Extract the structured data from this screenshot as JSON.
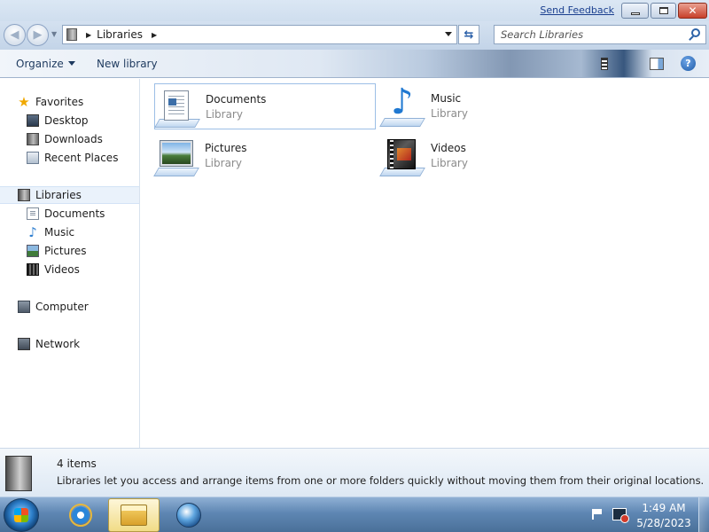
{
  "titlebar": {
    "feedback_link": "Send Feedback",
    "minimize": "minimize",
    "maximize": "maximize",
    "close": "✕"
  },
  "address": {
    "crumb": "Libraries",
    "search_placeholder": "Search Libraries"
  },
  "toolbar": {
    "organize_label": "Organize",
    "new_library_label": "New library",
    "help_label": "?"
  },
  "nav": {
    "favorites": "Favorites",
    "desktop": "Desktop",
    "downloads": "Downloads",
    "recent_places": "Recent Places",
    "libraries": "Libraries",
    "documents": "Documents",
    "music": "Music",
    "pictures": "Pictures",
    "videos": "Videos",
    "computer": "Computer",
    "network": "Network"
  },
  "libraries": [
    {
      "name": "Documents",
      "type": "Library",
      "icon": "documents-library-icon"
    },
    {
      "name": "Music",
      "type": "Library",
      "icon": "music-library-icon"
    },
    {
      "name": "Pictures",
      "type": "Library",
      "icon": "pictures-library-icon"
    },
    {
      "name": "Videos",
      "type": "Library",
      "icon": "videos-library-icon"
    }
  ],
  "details": {
    "count": "4 items",
    "description": "Libraries let you access and arrange items from one or more folders quickly without moving them from their original locations."
  },
  "taskbar": {
    "time": "1:49 AM",
    "date": "5/28/2023"
  },
  "colors": {
    "accent": "#2d63a8",
    "selection_border": "#9cbfe6",
    "taskbar": "#5e86b3"
  }
}
